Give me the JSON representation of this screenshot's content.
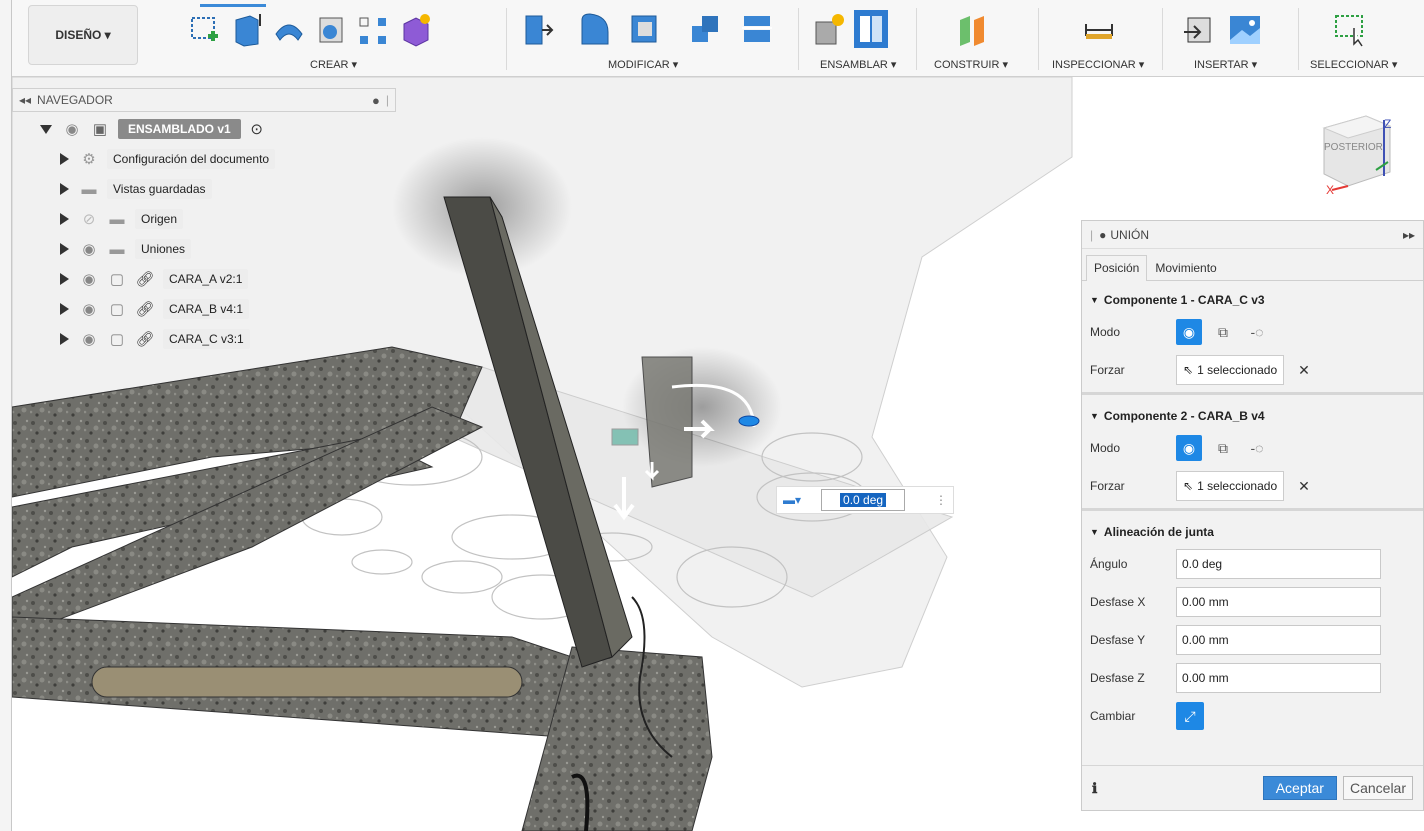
{
  "toolbar": {
    "design_label": "DISEÑO ▾",
    "groups": {
      "create": "CREAR ▾",
      "modify": "MODIFICAR ▾",
      "assemble": "ENSAMBLAR ▾",
      "construct": "CONSTRUIR ▾",
      "inspect": "INSPECCIONAR ▾",
      "insert": "INSERTAR ▾",
      "select": "SELECCIONAR ▾"
    }
  },
  "browser": {
    "title": "NAVEGADOR",
    "root": "ENSAMBLADO v1",
    "items": [
      {
        "label": "Configuración del documento",
        "icon": "gear-icon"
      },
      {
        "label": "Vistas guardadas",
        "icon": "folder-icon"
      },
      {
        "label": "Origen",
        "icon": "folder-icon"
      },
      {
        "label": "Uniones",
        "icon": "folder-icon"
      },
      {
        "label": "CARA_A v2:1",
        "icon": "component-icon"
      },
      {
        "label": "CARA_B v4:1",
        "icon": "component-icon"
      },
      {
        "label": "CARA_C v3:1",
        "icon": "component-icon"
      }
    ]
  },
  "viewcube": {
    "face": "POSTERIOR",
    "x_axis": "X",
    "z_axis": "Z"
  },
  "floating_input": {
    "value": "0.0 deg"
  },
  "joint_panel": {
    "title": "UNIÓN",
    "tabs": [
      "Posición",
      "Movimiento"
    ],
    "component1": {
      "heading": "Componente 1 - CARA_C v3",
      "mode_label": "Modo",
      "snap_label": "Forzar",
      "snap_value": "1 seleccionado"
    },
    "component2": {
      "heading": "Componente 2 - CARA_B v4",
      "mode_label": "Modo",
      "snap_label": "Forzar",
      "snap_value": "1 seleccionado"
    },
    "alignment": {
      "heading": "Alineación de junta",
      "angle_label": "Ángulo",
      "angle_value": "0.0 deg",
      "offset_x_label": "Desfase X",
      "offset_x_value": "0.00 mm",
      "offset_y_label": "Desfase Y",
      "offset_y_value": "0.00 mm",
      "offset_z_label": "Desfase Z",
      "offset_z_value": "0.00 mm",
      "flip_label": "Cambiar"
    },
    "ok_label": "Aceptar",
    "cancel_label": "Cancelar"
  },
  "colors": {
    "accent": "#1e88e5",
    "accept": "#3b8ad8"
  }
}
